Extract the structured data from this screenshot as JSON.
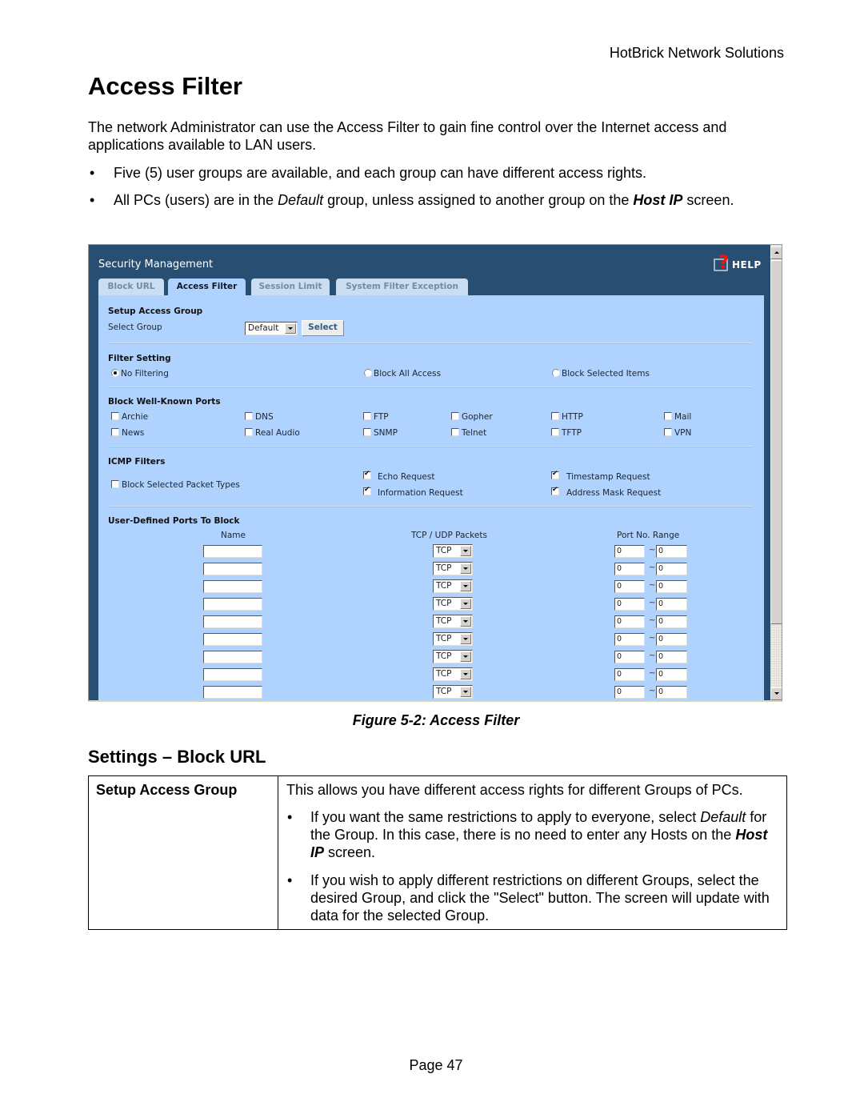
{
  "header": {
    "company": "HotBrick Network Solutions"
  },
  "page_title": "Access Filter",
  "intro": "The network Administrator can use the Access Filter to gain fine control over the Internet access and applications available to LAN users.",
  "bullets": [
    {
      "text": "Five (5) user groups are available, and each group can have different access rights."
    },
    {
      "pre": "All PCs (users) are in the ",
      "em": "Default",
      "mid": " group, unless assigned to another group on the ",
      "strong_em": "Host IP",
      "post": " screen."
    }
  ],
  "bullet_glyph": "•",
  "screenshot": {
    "title": "Security Management",
    "help_label": "HELP",
    "help_glyph": "?",
    "tabs": [
      {
        "label": "Block URL",
        "active": false
      },
      {
        "label": "Access Filter",
        "active": true
      },
      {
        "label": "Session Limit",
        "active": false
      },
      {
        "label": "System Filter Exception",
        "active": false
      }
    ],
    "setup_access_group": {
      "heading": "Setup Access Group",
      "select_label": "Select Group",
      "group_value": "Default",
      "select_button": "Select"
    },
    "filter_setting": {
      "heading": "Filter Setting",
      "options": [
        {
          "label": "No Filtering",
          "selected": true
        },
        {
          "label": "Block All Access",
          "selected": false
        },
        {
          "label": "Block Selected Items",
          "selected": false
        }
      ]
    },
    "well_known_ports": {
      "heading": "Block Well-Known Ports",
      "rows": [
        [
          {
            "label": "Archie",
            "checked": false
          },
          {
            "label": "DNS",
            "checked": false
          },
          {
            "label": "FTP",
            "checked": false
          },
          {
            "label": "Gopher",
            "checked": false
          },
          {
            "label": "HTTP",
            "checked": false
          },
          {
            "label": "Mail",
            "checked": false
          }
        ],
        [
          {
            "label": "News",
            "checked": false
          },
          {
            "label": "Real Audio",
            "checked": false
          },
          {
            "label": "SNMP",
            "checked": false
          },
          {
            "label": "Telnet",
            "checked": false
          },
          {
            "label": "TFTP",
            "checked": false
          },
          {
            "label": "VPN",
            "checked": false
          }
        ]
      ]
    },
    "icmp_filters": {
      "heading": "ICMP Filters",
      "block_label": "Block Selected Packet Types",
      "block_checked": false,
      "types": [
        {
          "label": "Echo Request",
          "checked": true
        },
        {
          "label": "Timestamp Request",
          "checked": true
        },
        {
          "label": "Information Request",
          "checked": true
        },
        {
          "label": "Address Mask Request",
          "checked": true
        }
      ]
    },
    "user_defined_ports": {
      "heading": "User-Defined Ports To Block",
      "col_name": "Name",
      "col_protocol": "TCP / UDP Packets",
      "col_range": "Port No. Range",
      "range_separator": "~",
      "rows": [
        {
          "name": "",
          "protocol": "TCP",
          "from": "0",
          "to": "0"
        },
        {
          "name": "",
          "protocol": "TCP",
          "from": "0",
          "to": "0"
        },
        {
          "name": "",
          "protocol": "TCP",
          "from": "0",
          "to": "0"
        },
        {
          "name": "",
          "protocol": "TCP",
          "from": "0",
          "to": "0"
        },
        {
          "name": "",
          "protocol": "TCP",
          "from": "0",
          "to": "0"
        },
        {
          "name": "",
          "protocol": "TCP",
          "from": "0",
          "to": "0"
        },
        {
          "name": "",
          "protocol": "TCP",
          "from": "0",
          "to": "0"
        },
        {
          "name": "",
          "protocol": "TCP",
          "from": "0",
          "to": "0"
        },
        {
          "name": "",
          "protocol": "TCP",
          "from": "0",
          "to": "0"
        }
      ]
    }
  },
  "figure_caption": "Figure 5-2: Access Filter",
  "settings_heading": "Settings – Block URL",
  "settings_table": {
    "term": "Setup Access Group",
    "description": "This allows you have different access rights for different Groups of PCs.",
    "bullets": [
      {
        "pre": "If you want the same restrictions to apply to everyone, select ",
        "em": "Default",
        "mid": " for the Group. In this case, there is no need to enter any Hosts on the ",
        "strong_em": "Host IP",
        "post": " screen."
      },
      {
        "text": "If you wish to apply different restrictions on different Groups, select the desired Group, and click the \"Select\" button. The screen will update with data for the selected Group."
      }
    ]
  },
  "footer": {
    "page": "Page 47"
  }
}
